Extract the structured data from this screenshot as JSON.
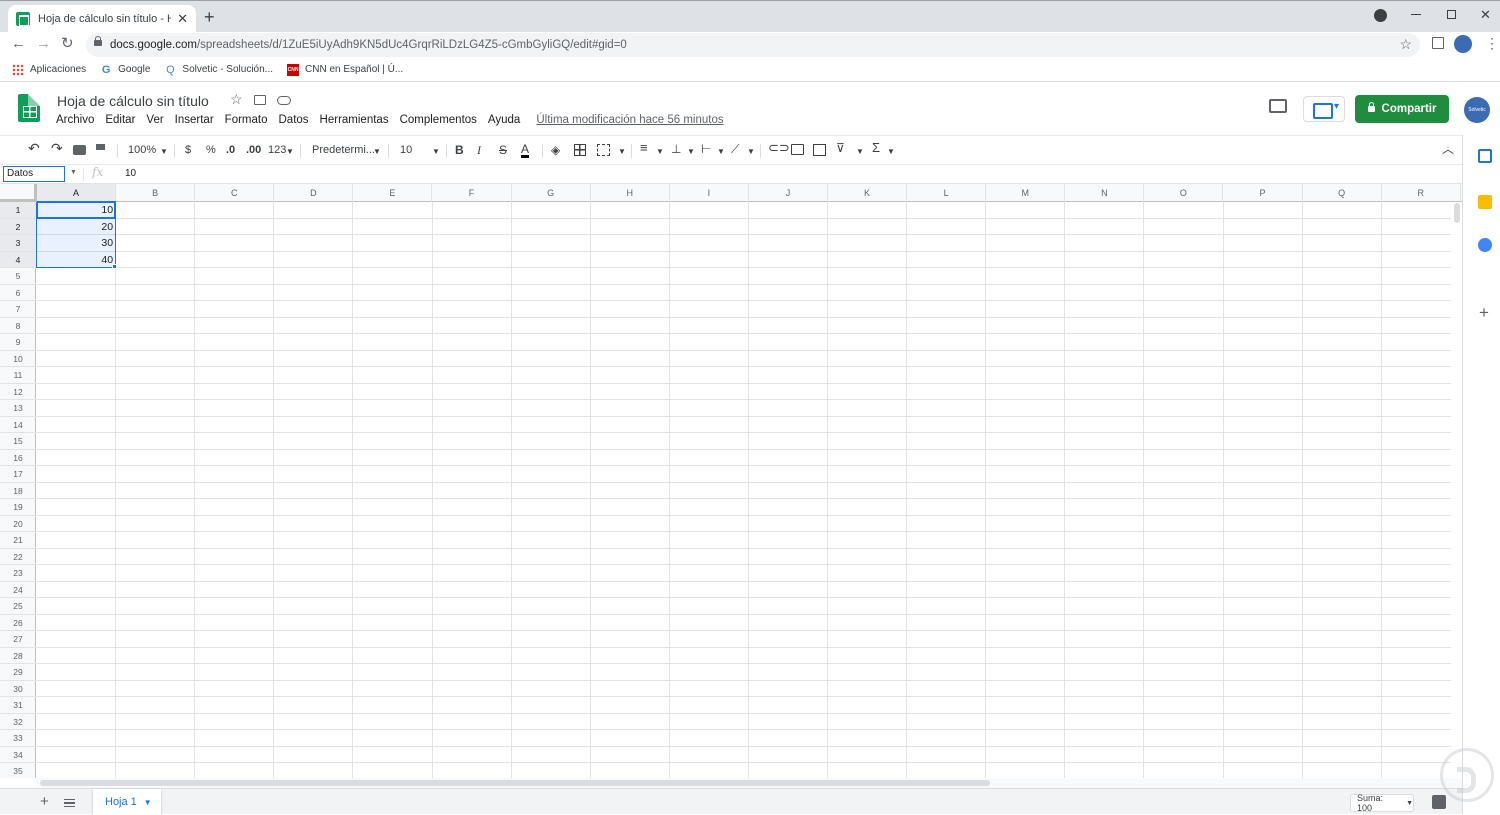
{
  "browser": {
    "tab_title": "Hoja de cálculo sin título - Hojas",
    "tab_close": "✕",
    "new_tab": "+",
    "url_host": "docs.google.com",
    "url_path": "/spreadsheets/d/1ZuE5iUyAdh9KN5dUc4GrqrRiLDzLG4Z5-cGmbGyliGQ/edit#gid=0",
    "bookmarks": [
      {
        "label": "Aplicaciones",
        "icon": "apps-grid-icon"
      },
      {
        "label": "Google",
        "icon": "google-icon"
      },
      {
        "label": "Solvetic - Solución...",
        "icon": "solvetic-icon"
      },
      {
        "label": "CNN en Español | Ú...",
        "icon": "cnn-icon"
      }
    ]
  },
  "doc": {
    "title": "Hoja de cálculo sin título",
    "menu": [
      "Archivo",
      "Editar",
      "Ver",
      "Insertar",
      "Formato",
      "Datos",
      "Herramientas",
      "Complementos",
      "Ayuda"
    ],
    "last_modified": "Última modificación hace 56 minutos",
    "share_label": "Compartir",
    "avatar_text": "Solvetic"
  },
  "toolbar": {
    "zoom": "100%",
    "currency": "$",
    "percent": "%",
    "dec_decrease": ".0",
    "dec_increase": ".00",
    "more_formats": "123",
    "font": "Predetermi...",
    "font_size": "10",
    "bold": "B",
    "italic": "I",
    "strike": "S",
    "text_color": "A",
    "functions": "Σ"
  },
  "formula_bar": {
    "name_box": "Datos",
    "fx": "fx",
    "value": "10"
  },
  "grid": {
    "columns": [
      "A",
      "B",
      "C",
      "D",
      "E",
      "F",
      "G",
      "H",
      "I",
      "J",
      "K",
      "L",
      "M",
      "N",
      "O",
      "P",
      "Q",
      "R"
    ],
    "rows": [
      "1",
      "2",
      "3",
      "4",
      "5",
      "6",
      "7",
      "8",
      "9",
      "10",
      "11",
      "12",
      "13",
      "14",
      "15",
      "16",
      "17",
      "18",
      "19",
      "20",
      "21",
      "22",
      "23",
      "24",
      "25",
      "26",
      "27",
      "28",
      "29",
      "30",
      "31",
      "32",
      "33",
      "34",
      "35"
    ],
    "cells": [
      {
        "ref": "A1",
        "value": "10"
      },
      {
        "ref": "A2",
        "value": "20"
      },
      {
        "ref": "A3",
        "value": "30"
      },
      {
        "ref": "A4",
        "value": "40"
      }
    ],
    "selection": "A1:A4"
  },
  "bottom": {
    "sheet_name": "Hoja 1",
    "sum": "Suma: 100"
  },
  "colors": {
    "accent": "#1a73e8",
    "share_green": "#1e8e3e",
    "sheets_green": "#0f9d58"
  }
}
